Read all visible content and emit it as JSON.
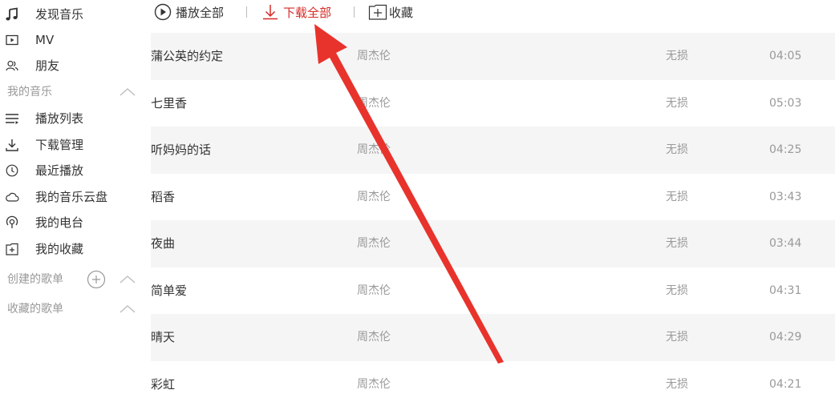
{
  "sidebar": {
    "nav_top": [
      {
        "label": "发现音乐",
        "icon": "music-note-icon"
      },
      {
        "label": "MV",
        "icon": "video-icon"
      },
      {
        "label": "朋友",
        "icon": "friends-icon"
      }
    ],
    "my_music": {
      "label": "我的音乐",
      "items": [
        {
          "label": "播放列表",
          "icon": "playlist-icon"
        },
        {
          "label": "下载管理",
          "icon": "download-icon"
        },
        {
          "label": "最近播放",
          "icon": "clock-icon"
        },
        {
          "label": "我的音乐云盘",
          "icon": "cloud-icon"
        },
        {
          "label": "我的电台",
          "icon": "radio-icon"
        },
        {
          "label": "我的收藏",
          "icon": "collection-icon"
        }
      ]
    },
    "created_playlists_label": "创建的歌单",
    "collected_playlists_label": "收藏的歌单"
  },
  "toolbar": {
    "play_all": "播放全部",
    "download_all": "下载全部",
    "collect": "收藏"
  },
  "songs": [
    {
      "title": "蒲公英的约定",
      "artist": "周杰伦",
      "quality": "无损",
      "duration": "04:05"
    },
    {
      "title": "七里香",
      "artist": "周杰伦",
      "quality": "无损",
      "duration": "05:03"
    },
    {
      "title": "听妈妈的话",
      "artist": "周杰伦",
      "quality": "无损",
      "duration": "04:25"
    },
    {
      "title": "稻香",
      "artist": "周杰伦",
      "quality": "无损",
      "duration": "03:43"
    },
    {
      "title": "夜曲",
      "artist": "周杰伦",
      "quality": "无损",
      "duration": "03:44"
    },
    {
      "title": "简单爱",
      "artist": "周杰伦",
      "quality": "无损",
      "duration": "04:31"
    },
    {
      "title": "晴天",
      "artist": "周杰伦",
      "quality": "无损",
      "duration": "04:29"
    },
    {
      "title": "彩虹",
      "artist": "周杰伦",
      "quality": "无损",
      "duration": "04:21"
    }
  ],
  "colors": {
    "accent": "#d52a26",
    "arrow": "#e8332c",
    "row_alt": "#f5f5f5",
    "muted_text": "#999999"
  }
}
